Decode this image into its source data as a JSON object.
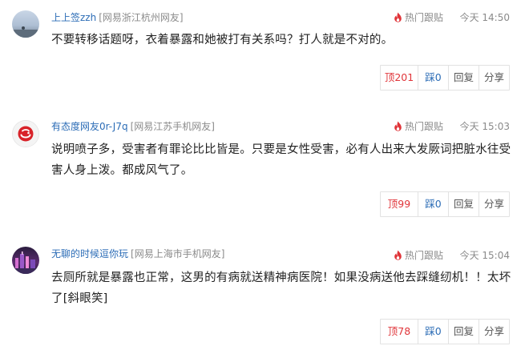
{
  "comments": [
    {
      "username": "上上签zzh",
      "location": "[网易浙江杭州网友]",
      "hot_label": "热门跟贴",
      "time": "今天 14:50",
      "text": "不要转移话题呀，衣着暴露和她被打有关系吗？打人就是不对的。",
      "up_label": "顶201",
      "down_label": "踩0",
      "reply_label": "回复",
      "share_label": "分享"
    },
    {
      "username": "有态度网友0r-J7q",
      "location": "[网易江苏手机网友]",
      "hot_label": "热门跟贴",
      "time": "今天 15:03",
      "text": "说明喷子多，受害者有罪论比比皆是。只要是女性受害，必有人出来大发厥词把脏水往受害人身上泼。都成风气了。",
      "up_label": "顶99",
      "down_label": "踩0",
      "reply_label": "回复",
      "share_label": "分享"
    },
    {
      "username": "无聊的时候逗你玩",
      "location": "[网易上海市手机网友]",
      "hot_label": "热门跟贴",
      "time": "今天 15:04",
      "text": "去厕所就是暴露也正常，这男的有病就送精神病医院！如果没病送他去踩缝纫机！！太坏了[斜眼笑]",
      "up_label": "顶78",
      "down_label": "踩0",
      "reply_label": "回复",
      "share_label": "分享"
    }
  ],
  "colors": {
    "username": "#2b6cb6",
    "up": "#e0353a",
    "down": "#2b6cb6",
    "hot_icon": "#e0353a",
    "meta": "#8a8a8a"
  },
  "icons": {
    "hot": "flame-icon"
  }
}
